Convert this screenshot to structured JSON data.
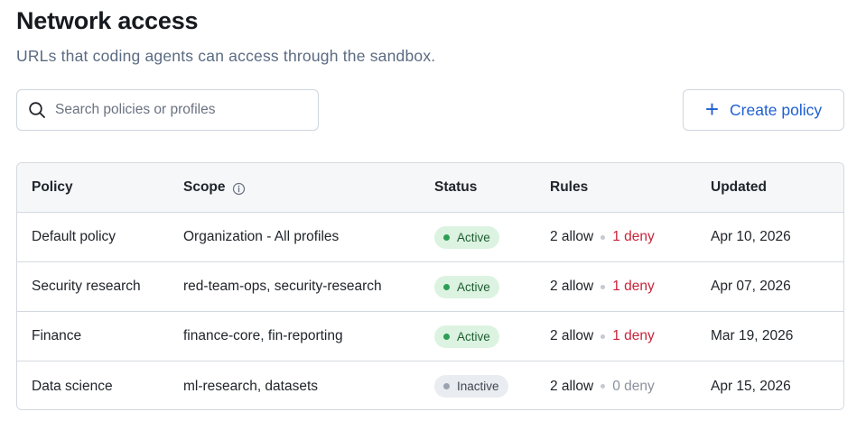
{
  "header": {
    "title": "Network access",
    "subtitle": "URLs that coding agents can access through the sandbox."
  },
  "search": {
    "placeholder": "Search policies or profiles",
    "value": ""
  },
  "actions": {
    "create_label": "Create policy"
  },
  "table": {
    "columns": {
      "policy": "Policy",
      "scope": "Scope",
      "status": "Status",
      "rules": "Rules",
      "updated": "Updated"
    },
    "rows": [
      {
        "policy": "Default policy",
        "scope": "Organization - All profiles",
        "status": "Active",
        "allow": "2 allow",
        "deny": "1 deny",
        "updated": "Apr 10, 2026"
      },
      {
        "policy": "Security research",
        "scope": "red-team-ops, security-research",
        "status": "Active",
        "allow": "2 allow",
        "deny": "1 deny",
        "updated": "Apr 07, 2026"
      },
      {
        "policy": "Finance",
        "scope": "finance-core, fin-reporting",
        "status": "Active",
        "allow": "2 allow",
        "deny": "1 deny",
        "updated": "Mar 19, 2026"
      },
      {
        "policy": "Data science",
        "scope": "ml-research, datasets",
        "status": "Inactive",
        "allow": "2 allow",
        "deny": "0 deny",
        "updated": "Apr 15, 2026"
      }
    ]
  },
  "icons": {
    "search": "search-icon",
    "plus": "plus-icon",
    "info": "info-icon"
  },
  "colors": {
    "accent": "#1f5fd1",
    "active_bg": "#dcf3e1",
    "active_dot": "#2f9e55",
    "inactive_bg": "#e9ecf0",
    "deny": "#c8243a"
  }
}
